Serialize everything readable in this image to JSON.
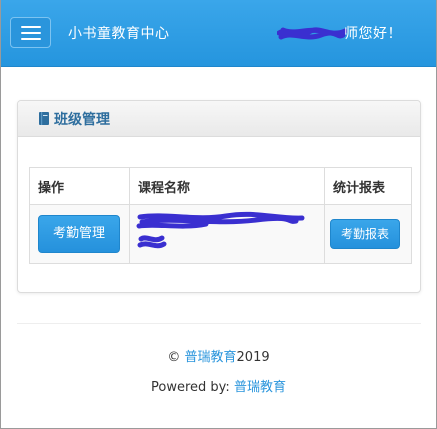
{
  "header": {
    "brand": "小书童教育中心",
    "greeting": "师您好！",
    "menu_icon": "hamburger-menu-icon"
  },
  "panel": {
    "icon": "book-icon",
    "title": "班级管理"
  },
  "table": {
    "headers": [
      "操作",
      "课程名称",
      "统计报表"
    ],
    "rows": [
      {
        "action_label": "考勤管理",
        "report_label": "考勤报表"
      }
    ]
  },
  "footer": {
    "copyright_symbol": "©",
    "company_link": "普瑞教育",
    "year": "2019",
    "powered_prefix": "Powered by:",
    "powered_link": "普瑞教育"
  },
  "colors": {
    "accent": "#2a95dc",
    "redaction": "#3a2fd0"
  }
}
